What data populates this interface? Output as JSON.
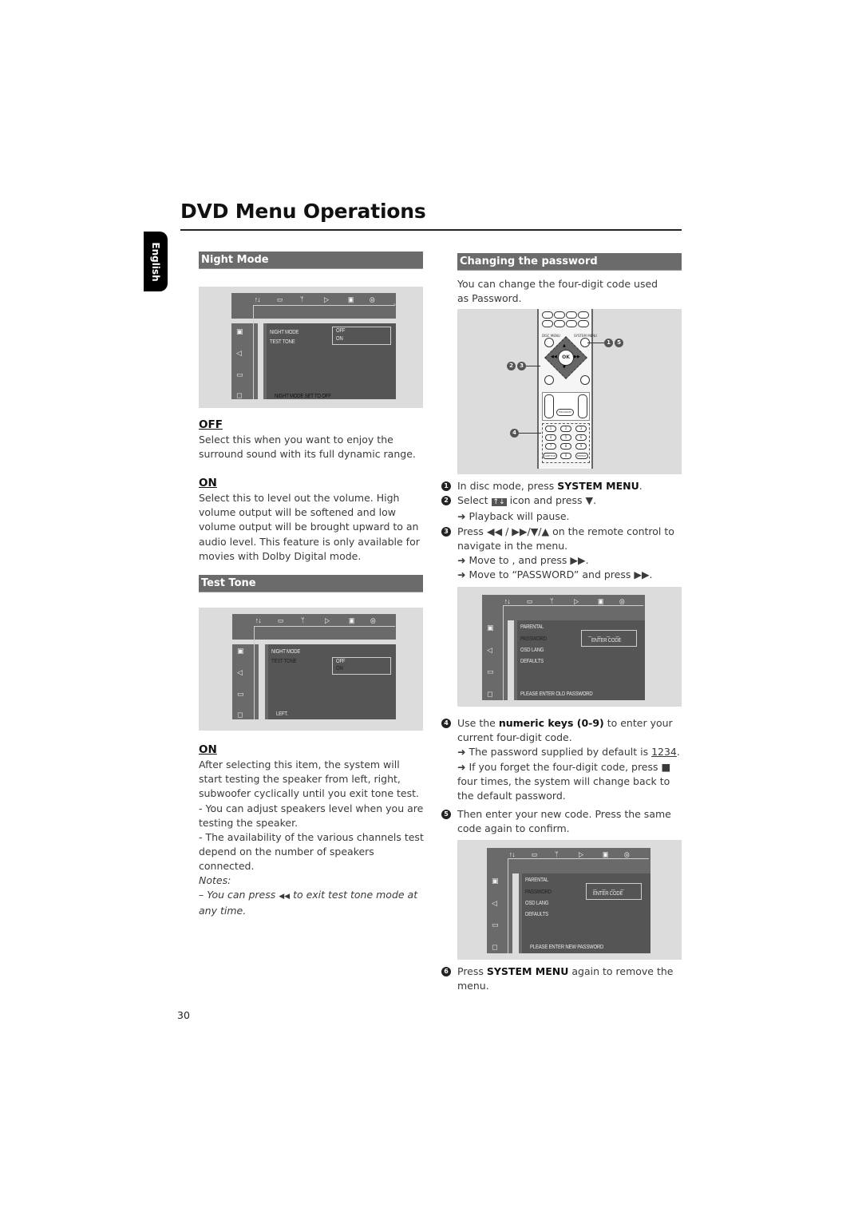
{
  "header": {
    "title": "DVD Menu Operations",
    "language_tab": "English"
  },
  "night_mode": {
    "heading": "Night Mode",
    "osd": {
      "top_icons": [
        "↑↓",
        "▭",
        "ᛘ",
        "▷",
        "▣",
        "◎"
      ],
      "menu_items": [
        "NIGHT MODE",
        "TEST TONE"
      ],
      "options": [
        "OFF",
        "ON"
      ],
      "status": "NIGHT MODE SET TO OFF"
    },
    "off_heading": "OFF",
    "off_text": "Select this when you want to enjoy the surround sound with its full dynamic range.",
    "on_heading": "ON",
    "on_text": "Select this to level out the volume. High volume output will be softened and low volume output will be brought upward to an audio level. This feature is only available for movies with Dolby Digital mode."
  },
  "test_tone": {
    "heading": "Test Tone",
    "osd": {
      "menu_items": [
        "NIGHT MODE",
        "TEST TONE"
      ],
      "options": [
        "OFF",
        "ON"
      ],
      "status": "LEFT."
    },
    "on_heading": "ON",
    "on_text_1": "After selecting this item, the system will start testing the speaker from left,  right,  subwoofer cyclically until you exit tone test.",
    "on_text_2": " - You can adjust speakers level when you are testing the speaker.",
    "on_text_3": " - The availability of the various channels test depend on the number of speakers connected.",
    "notes_label": "Notes:",
    "note_prefix": "–  You can press",
    "note_symbol": "◀◀",
    "note_suffix": " to exit test tone mode at any time."
  },
  "password": {
    "heading": "Changing the password",
    "intro": "You can change the four-digit code used as Password.",
    "remote": {
      "ok_label": "OK",
      "callouts": [
        "1 5",
        "2 3",
        "4"
      ],
      "keypad": [
        "1",
        "2",
        "3",
        "4",
        "5",
        "6",
        "7",
        "8",
        "9",
        "0"
      ],
      "labels": [
        "DISC MENU",
        "SYSTEM MENU",
        "PROGRAM",
        "SUBTITLE",
        "REPEAT"
      ]
    },
    "steps": [
      {
        "num": "1",
        "pre": "In disc mode, press ",
        "bold": "SYSTEM MENU",
        "post": "."
      },
      {
        "num": "2",
        "pre": "Select ",
        "icon": "↑↓",
        "post": " icon and press ▼."
      },
      {
        "num": "",
        "arrow": "➜",
        "text": "Playback will pause."
      },
      {
        "num": "3",
        "text": "Press ◀◀ / ▶▶/▼/▲  on the remote control to navigate in the menu."
      },
      {
        "num": "",
        "arrow": "➜",
        "text": "Move to    , and press ▶▶."
      },
      {
        "num": "",
        "arrow": "➜",
        "text": "Move to “PASSWORD” and press ▶▶."
      }
    ],
    "osd_old": {
      "menu_items": [
        "PARENTAL",
        "PASSWORD",
        "OSD LANG",
        "DEFAULTS"
      ],
      "code_placeholder": "_ _ _ _",
      "code_label": "ENTER CODE",
      "status": "PLEASE ENTER OLD PASSWORD"
    },
    "step4": {
      "num": "4",
      "pre": "Use the ",
      "bold": "numeric keys (0-9)",
      "post": " to enter your current four-digit code.",
      "arrow1_pre": "The password supplied by default is ",
      "default_code": "1234",
      "arrow1_post": ".",
      "arrow2": "If you forget the four-digit code, press ■ four times, the system will change back to the default password."
    },
    "step5": {
      "num": "5",
      "text": "Then enter your new code. Press the same code again to confirm."
    },
    "osd_new": {
      "menu_items": [
        "PARENTAL",
        "PASSWORD",
        "OSD LANG",
        "DEFAULTS"
      ],
      "code_placeholder": "_ _ _ _",
      "code_label": "ENTER CODE",
      "status": "PLEASE ENTER NEW PASSWORD"
    },
    "step6": {
      "num": "6",
      "pre": "Press ",
      "bold": "SYSTEM MENU",
      "post": " again to remove the menu."
    }
  },
  "footer": {
    "page_number": "30"
  }
}
